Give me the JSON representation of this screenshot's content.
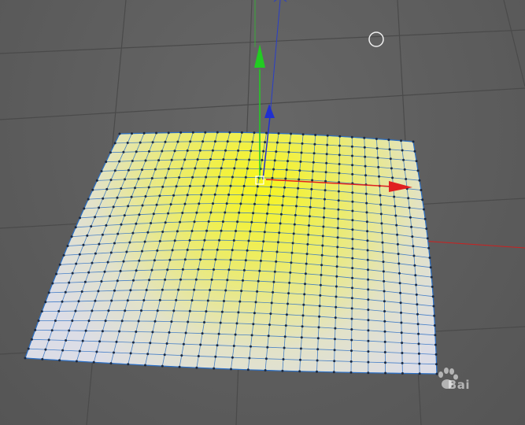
{
  "viewport": {
    "background": "#5e5e5e",
    "grid_line_color": "#4a4a4a",
    "axis_x_color": "#e02020",
    "axis_y_color": "#22cc22",
    "axis_z_color": "#2030d0"
  },
  "object": {
    "name_hint": "pillow-mesh",
    "fill_center": "#f2f21a",
    "fill_edge": "#e6e6ea",
    "wire_color": "#2b6fc4",
    "vertex_color": "#1a2a44"
  },
  "gizmo": {
    "icons": [
      "move-gizmo",
      "axis-x-arrow",
      "axis-y-arrow",
      "axis-z-arrow",
      "cursor-circle-icon"
    ]
  },
  "watermark": {
    "text": "Bai"
  }
}
